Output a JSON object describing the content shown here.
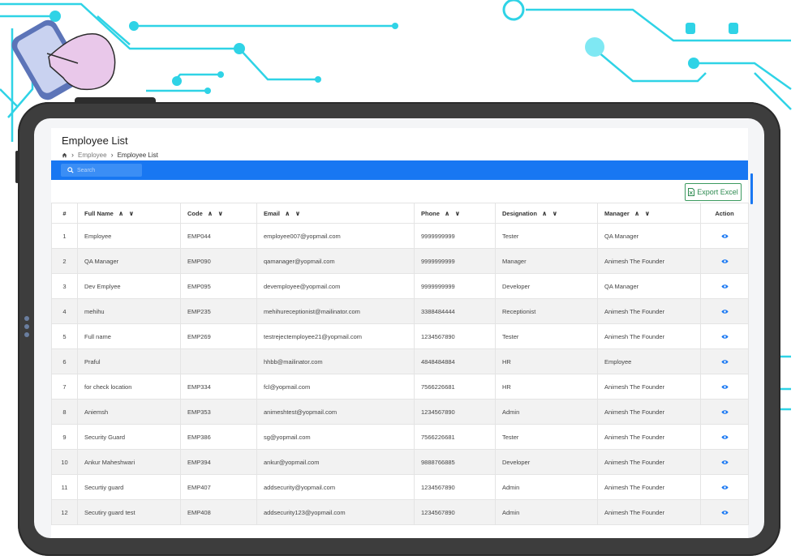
{
  "page": {
    "title": "Employee List",
    "breadcrumb": {
      "home_icon": "home-icon",
      "parent": "Employee",
      "current": "Employee List"
    }
  },
  "search": {
    "placeholder": "Search",
    "icon": "search-icon"
  },
  "export_button": {
    "label": "Export Excel",
    "icon": "excel-file-icon"
  },
  "colors": {
    "accent": "#1877f2",
    "export_green": "#2d8a50",
    "circuit": "#2fd3e6",
    "tablet": "#3d3d3d"
  },
  "table": {
    "columns": {
      "num": "#",
      "full_name": "Full Name",
      "code": "Code",
      "email": "Email",
      "phone": "Phone",
      "designation": "Designation",
      "manager": "Manager",
      "action": "Action"
    },
    "sort_glyph": "∧ ∨",
    "rows": [
      {
        "num": "1",
        "name": "Employee",
        "code": "EMP044",
        "email": "employee007@yopmail.com",
        "phone": "9999999999",
        "designation": "Tester",
        "manager": "QA Manager"
      },
      {
        "num": "2",
        "name": "QA Manager",
        "code": "EMP090",
        "email": "qamanager@yopmail.com",
        "phone": "9999999999",
        "designation": "Manager",
        "manager": "Animesh The Founder"
      },
      {
        "num": "3",
        "name": "Dev Emplyee",
        "code": "EMP095",
        "email": "devemployee@yopmail.com",
        "phone": "9999999999",
        "designation": "Developer",
        "manager": "QA Manager"
      },
      {
        "num": "4",
        "name": "mehihu",
        "code": "EMP235",
        "email": "mehihureceptionist@mailinator.com",
        "phone": "3388484444",
        "designation": "Receptionist",
        "manager": "Animesh The Founder"
      },
      {
        "num": "5",
        "name": "Full name",
        "code": "EMP269",
        "email": "testrejectemployee21@yopmail.com",
        "phone": "1234567890",
        "designation": "Tester",
        "manager": "Animesh The Founder"
      },
      {
        "num": "6",
        "name": "Praful",
        "code": "",
        "email": "hhbb@mailinator.com",
        "phone": "4848484884",
        "designation": "HR",
        "manager": "Employee"
      },
      {
        "num": "7",
        "name": "for check location",
        "code": "EMP334",
        "email": "fcl@yopmail.com",
        "phone": "7566226681",
        "designation": "HR",
        "manager": "Animesh The Founder"
      },
      {
        "num": "8",
        "name": "Aniemsh",
        "code": "EMP353",
        "email": "animeshtest@yopmail.com",
        "phone": "1234567890",
        "designation": "Admin",
        "manager": "Animesh The Founder"
      },
      {
        "num": "9",
        "name": "Security Guard",
        "code": "EMP386",
        "email": "sg@yopmail.com",
        "phone": "7566226681",
        "designation": "Tester",
        "manager": "Animesh The Founder"
      },
      {
        "num": "10",
        "name": "Ankur Maheshwari",
        "code": "EMP394",
        "email": "ankur@yopmail.com",
        "phone": "9888766885",
        "designation": "Developer",
        "manager": "Animesh The Founder"
      },
      {
        "num": "11",
        "name": "Securtiy guard",
        "code": "EMP407",
        "email": "addsecurity@yopmail.com",
        "phone": "1234567890",
        "designation": "Admin",
        "manager": "Animesh The Founder"
      },
      {
        "num": "12",
        "name": "Secutiry guard test",
        "code": "EMP408",
        "email": "addsecurity123@yopmail.com",
        "phone": "1234567890",
        "designation": "Admin",
        "manager": "Animesh The Founder"
      }
    ],
    "action_icon": "eye-icon"
  }
}
